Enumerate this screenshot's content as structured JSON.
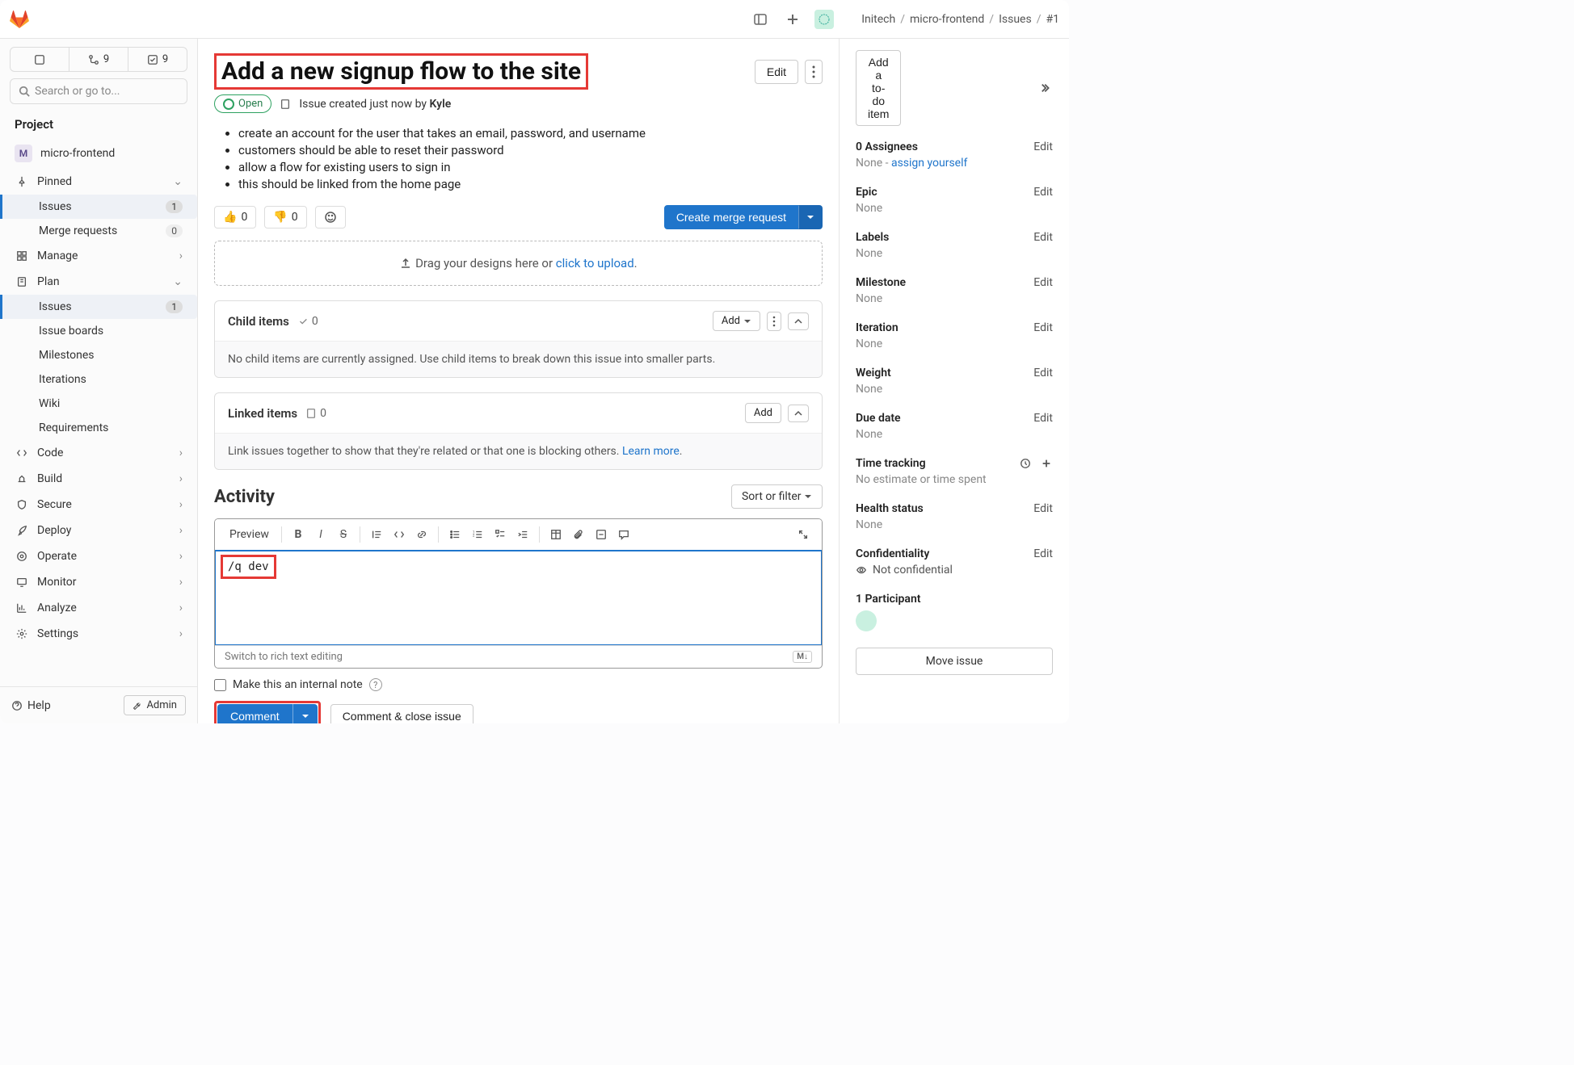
{
  "breadcrumb": {
    "org": "Initech",
    "project": "micro-frontend",
    "section": "Issues",
    "id": "#1"
  },
  "topcounts": {
    "mr": "9",
    "todo": "9"
  },
  "search_placeholder": "Search or go to...",
  "sidebar": {
    "section_project": "Project",
    "project_name": "micro-frontend",
    "project_initial": "M",
    "pinned_label": "Pinned",
    "pinned": [
      {
        "label": "Issues",
        "count": "1"
      },
      {
        "label": "Merge requests",
        "count": "0"
      }
    ],
    "manage": "Manage",
    "plan": "Plan",
    "plan_children": [
      {
        "label": "Issues",
        "count": "1"
      },
      {
        "label": "Issue boards"
      },
      {
        "label": "Milestones"
      },
      {
        "label": "Iterations"
      },
      {
        "label": "Wiki"
      },
      {
        "label": "Requirements"
      }
    ],
    "code": "Code",
    "build": "Build",
    "secure": "Secure",
    "deploy": "Deploy",
    "operate": "Operate",
    "monitor": "Monitor",
    "analyze": "Analyze",
    "settings": "Settings",
    "help": "Help",
    "admin": "Admin"
  },
  "issue": {
    "title": "Add a new signup flow to the site",
    "edit": "Edit",
    "status": "Open",
    "created_prefix": "Issue created just now by",
    "author": "Kyle",
    "desc": [
      "create an account for the user that takes an email, password, and username",
      "customers should be able to reset their password",
      "allow a flow for existing users to sign in",
      "this should be linked from the home page"
    ],
    "react_up": "0",
    "react_down": "0",
    "create_mr": "Create merge request",
    "drop_text": "Drag your designs here or ",
    "drop_link": "click to upload",
    "drop_suffix": ".",
    "child_title": "Child items",
    "child_count": "0",
    "child_add": "Add",
    "child_empty": "No child items are currently assigned. Use child items to break down this issue into smaller parts.",
    "linked_title": "Linked items",
    "linked_count": "0",
    "linked_add": "Add",
    "linked_empty_a": "Link issues together to show that they're related or that one is blocking others. ",
    "linked_learn": "Learn more",
    "linked_period": ".",
    "activity": "Activity",
    "sort_filter": "Sort or filter",
    "preview": "Preview",
    "comment_text": "/q dev",
    "switch_rich": "Switch to rich text editing",
    "md_badge": "M↓",
    "internal_note": "Make this an internal note",
    "comment_btn": "Comment",
    "comment_close": "Comment & close issue"
  },
  "right": {
    "add_todo": "Add a to-do item",
    "assignees_title": "0 Assignees",
    "assignees_none": "None - ",
    "assign_self": "assign yourself",
    "epic": "Epic",
    "epic_val": "None",
    "labels": "Labels",
    "labels_val": "None",
    "milestone": "Milestone",
    "milestone_val": "None",
    "iteration": "Iteration",
    "iteration_val": "None",
    "weight": "Weight",
    "weight_val": "None",
    "due": "Due date",
    "due_val": "None",
    "time": "Time tracking",
    "time_val": "No estimate or time spent",
    "health": "Health status",
    "health_val": "None",
    "confid": "Confidentiality",
    "confid_val": "Not confidential",
    "participants": "1 Participant",
    "move": "Move issue",
    "edit": "Edit"
  }
}
